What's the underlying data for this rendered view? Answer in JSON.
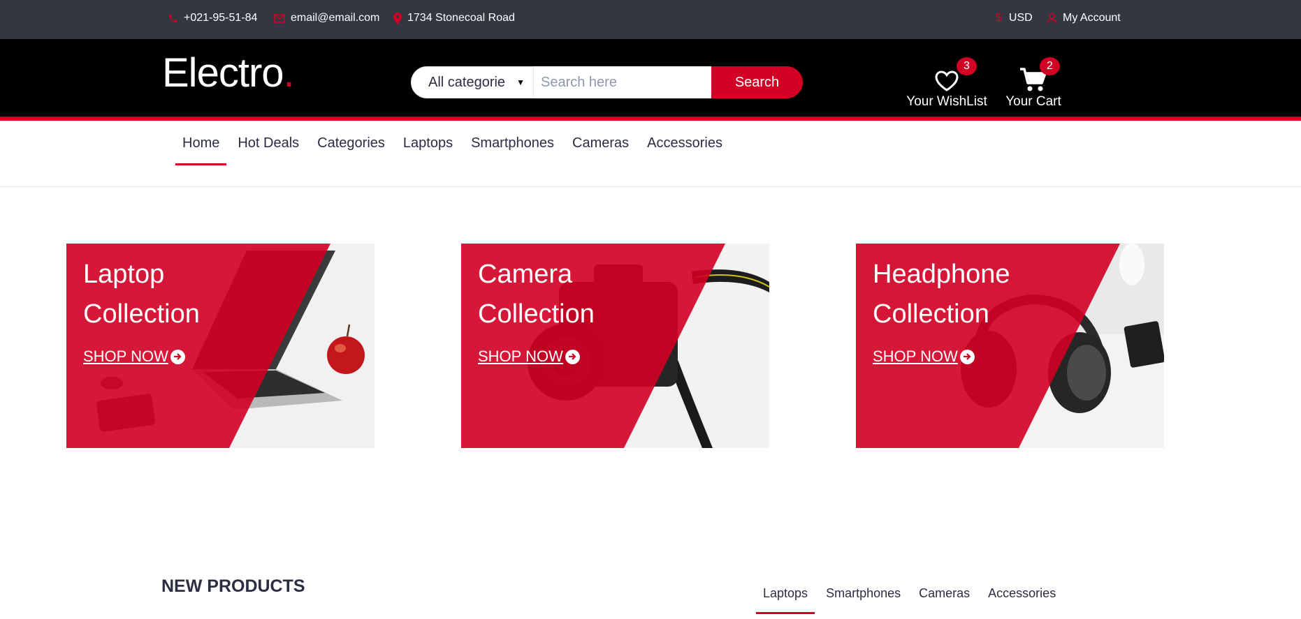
{
  "topbar": {
    "phone": "+021-95-51-84",
    "email": "email@email.com",
    "address": "1734 Stonecoal Road",
    "currency": "USD",
    "account": "My Account"
  },
  "header": {
    "logo_text": "Electro",
    "logo_dot": ".",
    "category_select": "All categorie",
    "search_placeholder": "Search here",
    "search_button": "Search",
    "wishlist_label": "Your WishList",
    "wishlist_count": "3",
    "cart_label": "Your Cart",
    "cart_count": "2"
  },
  "nav": {
    "items": [
      "Home",
      "Hot Deals",
      "Categories",
      "Laptops",
      "Smartphones",
      "Cameras",
      "Accessories"
    ],
    "active": "Home"
  },
  "collections": [
    {
      "title": "Laptop Collection",
      "cta": "SHOP NOW"
    },
    {
      "title": "Camera Collection",
      "cta": "SHOP NOW"
    },
    {
      "title": "Headphone Collection",
      "cta": "SHOP NOW"
    }
  ],
  "new_products": {
    "title": "NEW PRODUCTS",
    "tabs": [
      "Laptops",
      "Smartphones",
      "Cameras",
      "Accessories"
    ],
    "active_tab": "Laptops"
  },
  "colors": {
    "accent": "#d10024",
    "topbar_bg": "#333741",
    "header_bg": "#000000"
  }
}
